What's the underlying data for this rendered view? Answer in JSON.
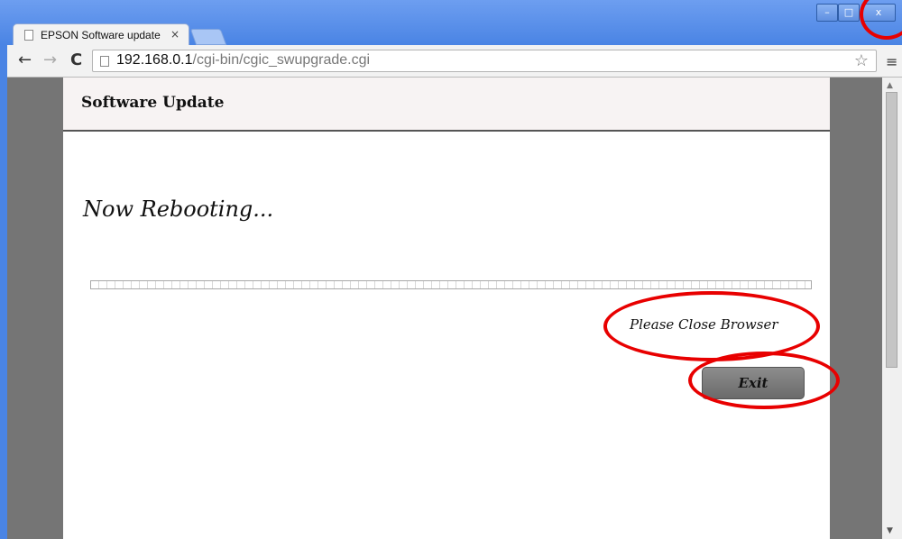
{
  "browser": {
    "tab_title": "EPSON Software update",
    "tab_close": "×",
    "url_host": "192.168.0.1",
    "url_path": "/cgi-bin/cgic_swupgrade.cgi",
    "icons": [
      "back-icon",
      "forward-icon",
      "reload-icon",
      "page-icon",
      "star-icon",
      "menu-icon"
    ]
  },
  "window_controls": {
    "minimize": "–",
    "maximize": "□",
    "close": "x"
  },
  "page": {
    "header_title": "Software Update",
    "status": "Now Rebooting...",
    "progress_percent": 0,
    "close_message": "Please Close Browser",
    "exit_label": "Exit"
  },
  "annotations": {
    "color": "#e80000",
    "circled": [
      "window-close-button",
      "close-browser-message",
      "exit-button"
    ]
  }
}
